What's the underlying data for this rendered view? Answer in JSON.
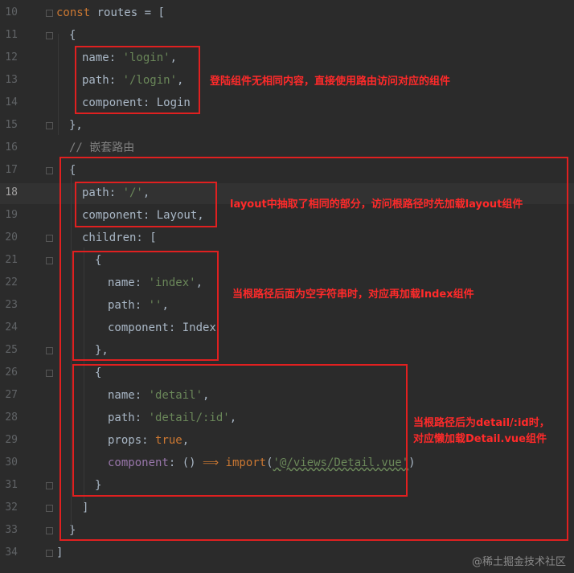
{
  "lines": [
    {
      "n": "10",
      "code": [
        [
          "kw",
          "const"
        ],
        [
          "id",
          " routes = ["
        ]
      ]
    },
    {
      "n": "11",
      "code": [
        [
          "id",
          "{"
        ]
      ]
    },
    {
      "n": "12",
      "code": [
        [
          "id",
          "name: "
        ],
        [
          "str",
          "'login'"
        ],
        [
          "id",
          ","
        ]
      ]
    },
    {
      "n": "13",
      "code": [
        [
          "id",
          "path: "
        ],
        [
          "str",
          "'/login'"
        ],
        [
          "id",
          ","
        ]
      ]
    },
    {
      "n": "14",
      "code": [
        [
          "id",
          "component: Login"
        ]
      ]
    },
    {
      "n": "15",
      "code": [
        [
          "id",
          "},"
        ]
      ]
    },
    {
      "n": "16",
      "code": [
        [
          "cm",
          "// 嵌套路由"
        ]
      ]
    },
    {
      "n": "17",
      "code": [
        [
          "id",
          "{"
        ]
      ]
    },
    {
      "n": "18",
      "code": [
        [
          "id",
          "path: "
        ],
        [
          "str",
          "'/'"
        ],
        [
          "id",
          ","
        ]
      ]
    },
    {
      "n": "19",
      "code": [
        [
          "id",
          "component: Layout,"
        ]
      ]
    },
    {
      "n": "20",
      "code": [
        [
          "id",
          "children: ["
        ]
      ]
    },
    {
      "n": "21",
      "code": [
        [
          "id",
          "{"
        ]
      ]
    },
    {
      "n": "22",
      "code": [
        [
          "id",
          "name: "
        ],
        [
          "str",
          "'index'"
        ],
        [
          "id",
          ","
        ]
      ]
    },
    {
      "n": "23",
      "code": [
        [
          "id",
          "path: "
        ],
        [
          "str",
          "''"
        ],
        [
          "id",
          ","
        ]
      ]
    },
    {
      "n": "24",
      "code": [
        [
          "id",
          "component: Index"
        ]
      ]
    },
    {
      "n": "25",
      "code": [
        [
          "id",
          "},"
        ]
      ]
    },
    {
      "n": "26",
      "code": [
        [
          "id",
          "{"
        ]
      ]
    },
    {
      "n": "27",
      "code": [
        [
          "id",
          "name: "
        ],
        [
          "str",
          "'detail'"
        ],
        [
          "id",
          ","
        ]
      ]
    },
    {
      "n": "28",
      "code": [
        [
          "id",
          "path: "
        ],
        [
          "str",
          "'detail/:id'"
        ],
        [
          "id",
          ","
        ]
      ]
    },
    {
      "n": "29",
      "code": [
        [
          "id",
          "props: "
        ],
        [
          "val",
          "true"
        ],
        [
          "id",
          ","
        ]
      ]
    },
    {
      "n": "30",
      "code": [
        [
          "prop",
          "component"
        ],
        [
          "id",
          ": () "
        ],
        [
          "kw",
          "⟹"
        ],
        [
          "id",
          " "
        ],
        [
          "kw",
          "import"
        ],
        [
          "id",
          "("
        ],
        [
          "str",
          "'@/views/Detail.vue'"
        ],
        [
          "id",
          ")"
        ]
      ]
    },
    {
      "n": "31",
      "code": [
        [
          "id",
          "}"
        ]
      ]
    },
    {
      "n": "32",
      "code": [
        [
          "id",
          "]"
        ]
      ]
    },
    {
      "n": "33",
      "code": [
        [
          "id",
          "}"
        ]
      ]
    },
    {
      "n": "34",
      "code": [
        [
          "id",
          "]"
        ]
      ]
    }
  ],
  "annotations": {
    "login_note": "登陆组件无相同内容，直接使用路由访问对应的组件",
    "layout_note": "layout中抽取了相同的部分，访问根路径时先加载layout组件",
    "index_note": "当根路径后面为空字符串时，对应再加载Index组件",
    "detail_note": "当根路径后为detail/:id时，\n对应懒加载Detail.vue组件"
  },
  "watermark": "@稀土掘金技术社区",
  "colors": {
    "background": "#2b2b2b",
    "annotation_red": "#e02020",
    "string_green": "#6a8759",
    "keyword_orange": "#cc7832"
  }
}
